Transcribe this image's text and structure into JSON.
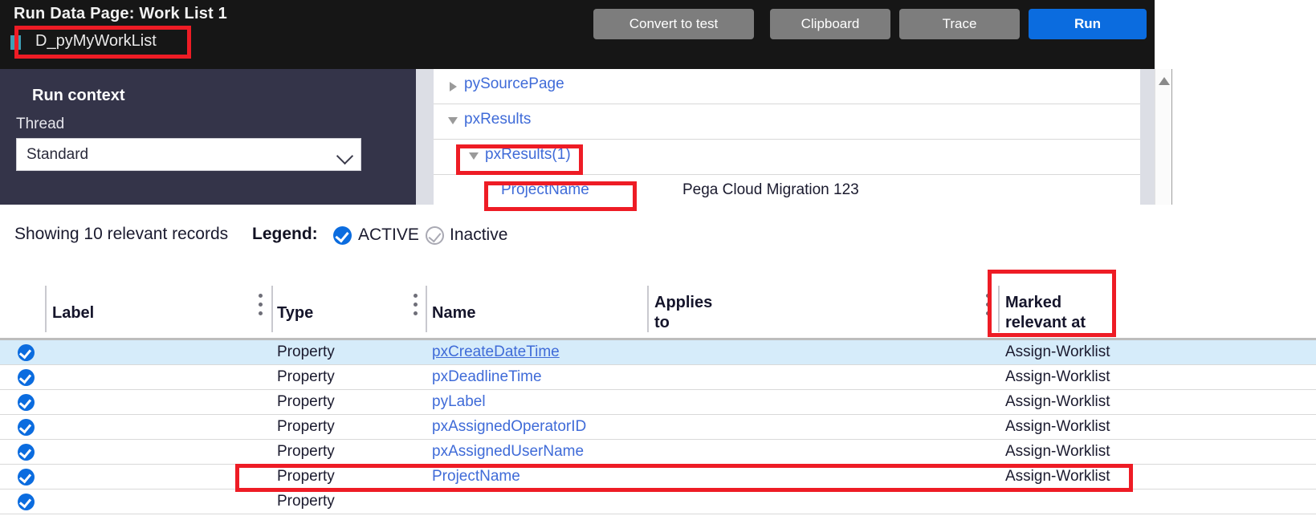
{
  "header": {
    "title": "Run  Data Page:  Work List 1",
    "data_page_name": "D_pyMyWorkList",
    "pause_icon": "pause-icon",
    "buttons": {
      "convert": "Convert to test",
      "clipboard": "Clipboard",
      "trace": "Trace",
      "run": "Run"
    },
    "colors": {
      "background": "#161616",
      "primary": "#0b6cdf",
      "secondary": "#7d7d7d"
    }
  },
  "run_context": {
    "title": "Run context",
    "thread_label": "Thread",
    "thread_value": "Standard",
    "background": "#343449"
  },
  "tree": {
    "rows": [
      {
        "label": "pySourcePage",
        "state": "collapsed",
        "indent": 20,
        "value": ""
      },
      {
        "label": "pxResults",
        "state": "expanded",
        "indent": 20,
        "value": ""
      },
      {
        "label": "pxResults(1)",
        "state": "expanded",
        "indent": 44,
        "value": ""
      },
      {
        "label": "ProjectName",
        "state": "leaf",
        "indent": 84,
        "value": "Pega Cloud Migration 123"
      }
    ],
    "scrollbar": "vertical-scrollbar"
  },
  "legend": {
    "showing": "Showing  10 relevant records",
    "legend_label": "Legend:",
    "active": "ACTIVE",
    "inactive": "Inactive",
    "active_color": "#0b6cdf",
    "inactive_color": "#a9a9b3"
  },
  "table": {
    "columns": [
      {
        "label": "Label"
      },
      {
        "label": "Type"
      },
      {
        "label": "Name"
      },
      {
        "label": "Applies\nto"
      },
      {
        "label": "Marked\nrelevant at"
      }
    ],
    "column_header_label": "Label",
    "column_header_type": "Type",
    "column_header_name": "Name",
    "column_header_applies_to_line1": "Applies",
    "column_header_applies_to_line2": "to",
    "column_header_marked_line1": "Marked",
    "column_header_marked_line2": "relevant at",
    "rows": [
      {
        "status": "ACTIVE",
        "label": "",
        "type": "Property",
        "name": "pxCreateDateTime",
        "applies_to": "",
        "marked_relevant_at": "Assign-Worklist",
        "highlighted": true,
        "hovered": true
      },
      {
        "status": "ACTIVE",
        "label": "",
        "type": "Property",
        "name": "pxDeadlineTime",
        "applies_to": "",
        "marked_relevant_at": "Assign-Worklist",
        "highlighted": false,
        "hovered": false
      },
      {
        "status": "ACTIVE",
        "label": "",
        "type": "Property",
        "name": "pyLabel",
        "applies_to": "",
        "marked_relevant_at": "Assign-Worklist",
        "highlighted": false,
        "hovered": false
      },
      {
        "status": "ACTIVE",
        "label": "",
        "type": "Property",
        "name": "pxAssignedOperatorID",
        "applies_to": "",
        "marked_relevant_at": "Assign-Worklist",
        "highlighted": false,
        "hovered": false
      },
      {
        "status": "ACTIVE",
        "label": "",
        "type": "Property",
        "name": "pxAssignedUserName",
        "applies_to": "",
        "marked_relevant_at": "Assign-Worklist",
        "highlighted": false,
        "hovered": false
      },
      {
        "status": "ACTIVE",
        "label": "",
        "type": "Property",
        "name": "ProjectName",
        "applies_to": "",
        "marked_relevant_at": "Assign-Worklist",
        "highlighted": false,
        "hovered": false
      },
      {
        "status": "ACTIVE",
        "label": "",
        "type": "Property",
        "name": "",
        "applies_to": "",
        "marked_relevant_at": "",
        "highlighted": false,
        "hovered": false
      }
    ]
  },
  "annotations": {
    "color": "#ee1c25",
    "boxes": [
      "data-page-name",
      "tree-pxResults(1)",
      "tree-ProjectName",
      "marked-relevant-at-column",
      "ProjectName-row"
    ]
  }
}
